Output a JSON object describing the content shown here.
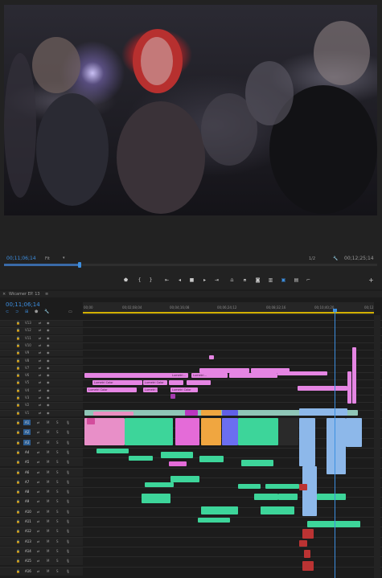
{
  "monitor": {
    "timecode": "00;11;06;14",
    "zoom": "Fit",
    "resolution": "1/2",
    "duration": "00;12;25;14",
    "controls": [
      "marker-icon",
      "in-point-icon",
      "out-point-icon",
      "go-to-in-icon",
      "step-back-icon",
      "stop-icon",
      "play-icon",
      "step-forward-icon",
      "go-to-out-icon",
      "insert-icon",
      "overwrite-icon",
      "export-frame-icon",
      "compare-icon",
      "toggle-icon",
      "trim-icon",
      "settings-icon"
    ],
    "add": "+"
  },
  "sequence": {
    "name": "Wicamer EP. 13",
    "timecode": "00;11;06;14",
    "ruler": [
      "00;00",
      "00;02;08;04",
      "00;04;16;08",
      "00;06;24;12",
      "00;08;32;16",
      "00;10;40;20",
      "00;12"
    ]
  },
  "tracks": {
    "video": [
      "V13",
      "V12",
      "V11",
      "V10",
      "V9",
      "V8",
      "V7",
      "V6",
      "V5",
      "V4",
      "V3",
      "V2",
      "V1"
    ],
    "audio": [
      "A1",
      "A2",
      "A3",
      "A4",
      "A5",
      "A6",
      "A7",
      "A8",
      "A9",
      "A10",
      "A11",
      "A12",
      "A13",
      "A14",
      "A15",
      "A16"
    ],
    "mute": "M",
    "solo": "S"
  },
  "clip_labels": {
    "lumetri1": "Lumetri Color",
    "lumetri2": "Lumetri Color",
    "lumetri3": "Lumetri Color",
    "lumetri4": "Lumetri Color",
    "lumetri5": "Lumetri Color",
    "lumetri6": "Lumetri...",
    "lumetri7": "Lumetri..."
  },
  "colors": {
    "video_clip": "#e585e3",
    "audio_clip": "#3dd59a",
    "nested_clip": "#8db8ea",
    "playhead": "#3d8fe0",
    "timecode": "#3d8fe0"
  }
}
